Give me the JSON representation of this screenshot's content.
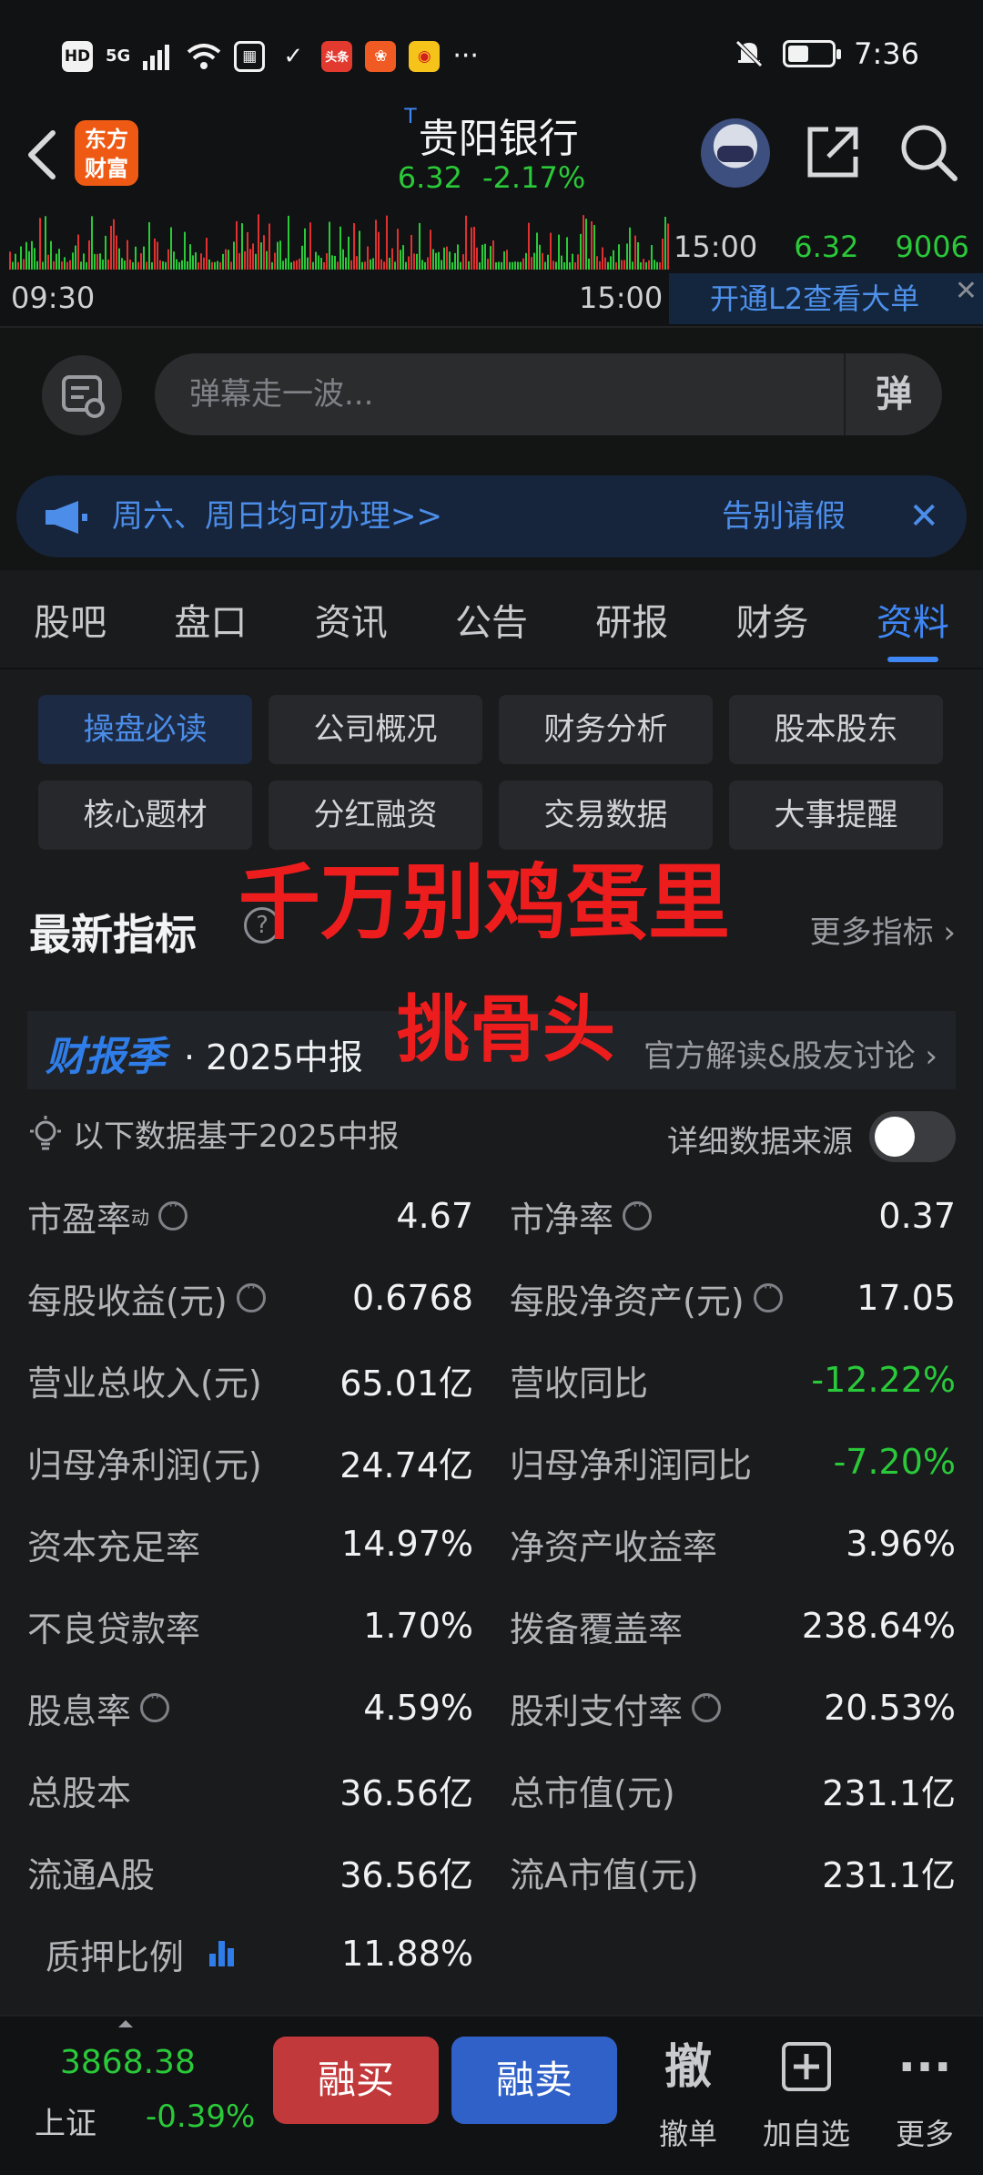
{
  "status_bar": {
    "time": "7:36",
    "hd": "HD",
    "net": "5G"
  },
  "header": {
    "logo_line1": "东方",
    "logo_line2": "财富",
    "stock_flag": "T",
    "stock_name": "贵阳银行",
    "price": "6.32",
    "change_pct": "-2.17%"
  },
  "minichart": {
    "time_start": "09:30",
    "time_end": "15:00",
    "tick_time": "15:00",
    "tick_price": "6.32",
    "tick_volume": "9006",
    "l2_text": "开通L2查看大单",
    "l2_close": "✕"
  },
  "danmaku": {
    "placeholder": "弹幕走一波...",
    "send_label": "弹"
  },
  "notice": {
    "text": "周六、周日均可办理>>",
    "text2": "告别请假",
    "close": "✕"
  },
  "tabs": [
    "股吧",
    "盘口",
    "资讯",
    "公告",
    "研报",
    "财务",
    "资料"
  ],
  "sub_buttons": [
    "操盘必读",
    "公司概况",
    "财务分析",
    "股本股东",
    "核心题材",
    "分红融资",
    "交易数据",
    "大事提醒"
  ],
  "overlay": {
    "line1": "千万别鸡蛋里",
    "line2": "挑骨头"
  },
  "section": {
    "title": "最新指标",
    "help": "?",
    "more": "更多指标 ›"
  },
  "report": {
    "label": "财报季",
    "period": "· 2025中报",
    "link": "官方解读&股友讨论 ›"
  },
  "basis": {
    "text": "以下数据基于2025中报",
    "source_label": "详细数据来源",
    "source_toggle_on": false
  },
  "metrics": [
    [
      {
        "label": "市盈率",
        "sup": "动",
        "info": true,
        "value": "4.67"
      },
      {
        "label": "市净率",
        "info": true,
        "value": "0.37"
      }
    ],
    [
      {
        "label": "每股收益(元)",
        "info": true,
        "value": "0.6768"
      },
      {
        "label": "每股净资产(元)",
        "info": true,
        "value": "17.05"
      }
    ],
    [
      {
        "label": "营业总收入(元)",
        "value": "65.01亿"
      },
      {
        "label": "营收同比",
        "value": "-12.22%",
        "green": true
      }
    ],
    [
      {
        "label": "归母净利润(元)",
        "value": "24.74亿"
      },
      {
        "label": "归母净利润同比",
        "value": "-7.20%",
        "green": true
      }
    ],
    [
      {
        "label": "资本充足率",
        "value": "14.97%"
      },
      {
        "label": "净资产收益率",
        "value": "3.96%"
      }
    ],
    [
      {
        "label": "不良贷款率",
        "value": "1.70%"
      },
      {
        "label": "拨备覆盖率",
        "value": "238.64%"
      }
    ],
    [
      {
        "label": "股息率",
        "info": true,
        "value": "4.59%"
      },
      {
        "label": "股利支付率",
        "info": true,
        "value": "20.53%"
      }
    ],
    [
      {
        "label": "总股本",
        "value": "36.56亿"
      },
      {
        "label": "总市值(元)",
        "value": "231.1亿"
      }
    ],
    [
      {
        "label": "流通A股",
        "value": "36.56亿"
      },
      {
        "label": "流A市值(元)",
        "value": "231.1亿"
      }
    ],
    [
      {
        "label": "质押比例",
        "chart": true,
        "value": "11.88%"
      }
    ]
  ],
  "bottom": {
    "index_value": "3868.38",
    "index_name": "上证",
    "index_change": "-0.39%",
    "buy_label": "融买",
    "sell_label": "融卖",
    "cancel_big": "撤",
    "cancel_label": "撤单",
    "add_label": "加自选",
    "more_label": "更多"
  },
  "colors": {
    "up_red": "#e03030",
    "down_green": "#2ac93a",
    "accent_blue": "#3f87f5"
  }
}
